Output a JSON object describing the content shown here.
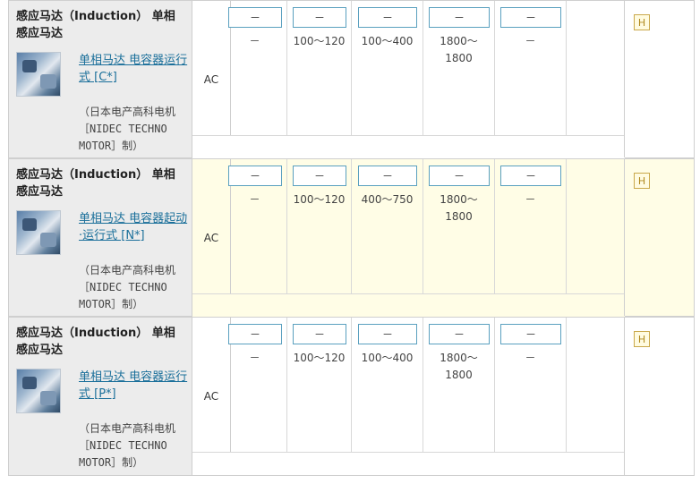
{
  "rows": [
    {
      "title": "感应马达（Induction） 单相感应马达",
      "link": "单相马达 电容器运行式 [C*]",
      "maker": "（日本电产高科电机［NIDEC TECHNO MOTOR］制）",
      "power": "AC",
      "filters": [
        "－",
        "－",
        "－",
        "－",
        "－"
      ],
      "values": [
        "－",
        "100～120",
        "100～400",
        "1800～\n1800",
        "－"
      ],
      "badge": "H"
    },
    {
      "title": "感应马达（Induction） 单相感应马达",
      "link": "单相马达 电容器起动·运行式 [N*]",
      "maker": "（日本电产高科电机［NIDEC TECHNO MOTOR］制）",
      "power": "AC",
      "filters": [
        "－",
        "－",
        "－",
        "－",
        "－"
      ],
      "values": [
        "－",
        "100～120",
        "400～750",
        "1800～\n1800",
        "－"
      ],
      "badge": "H"
    },
    {
      "title": "感应马达（Induction） 单相感应马达",
      "link": "单相马达 电容器运行式 [P*]",
      "maker": "（日本电产高科电机［NIDEC TECHNO MOTOR］制）",
      "power": "AC",
      "filters": [
        "－",
        "－",
        "－",
        "－",
        "－"
      ],
      "values": [
        "－",
        "100～120",
        "100～400",
        "1800～\n1800",
        "－"
      ],
      "badge": "H"
    }
  ]
}
